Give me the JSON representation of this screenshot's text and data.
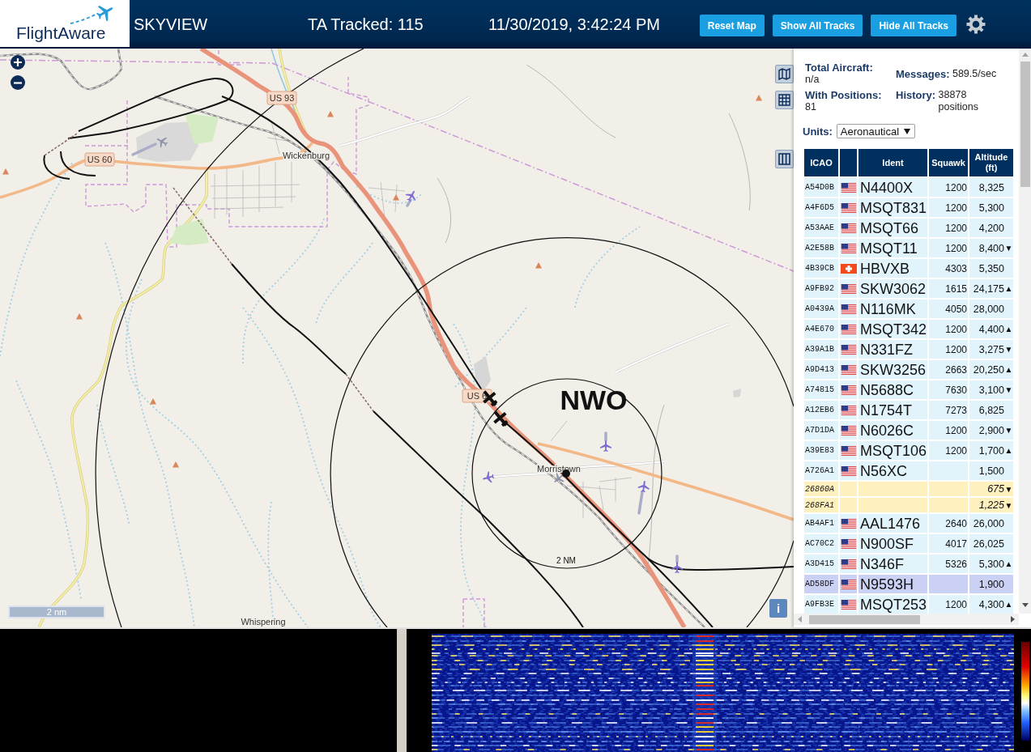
{
  "header": {
    "logo": "FlightAware",
    "title": "SKYVIEW",
    "tracked": "TA Tracked: 115",
    "datetime": "11/30/2019, 3:42:24 PM",
    "buttons": [
      "Reset Map",
      "Show All Tracks",
      "Hide All Tracks"
    ]
  },
  "map": {
    "route_shields": [
      "US 93",
      "US 60",
      "US 6"
    ],
    "places": [
      "Wickenburg",
      "Morristown",
      "Whispering"
    ],
    "airport": "NWO",
    "ring_label": "2 NM",
    "scale": "2 nm",
    "info_button": "i"
  },
  "stats": [
    {
      "label": "Total Aircraft:",
      "value": "n/a"
    },
    {
      "label": "Messages:",
      "value": "589.5/sec"
    },
    {
      "label": "With Positions:",
      "value": "81"
    },
    {
      "label": "History:",
      "value": "38878 positions"
    }
  ],
  "units": {
    "label": "Units:",
    "value": "Aeronautical"
  },
  "table": {
    "columns": [
      "ICAO",
      "Ident",
      "Squawk",
      "Altitude (ft)"
    ],
    "rows": [
      {
        "icao": "A54D0B",
        "flag": {
          "kind": "us"
        },
        "ident": "N4400X",
        "squawk": "1200",
        "altitude": "8,325",
        "kind": "standard",
        "selected": false
      },
      {
        "icao": "A4F6D5",
        "flag": {
          "kind": "us"
        },
        "ident": "MSQT831",
        "squawk": "1200",
        "altitude": "5,300",
        "kind": "standard",
        "selected": false
      },
      {
        "icao": "A53AAE",
        "flag": {
          "kind": "us"
        },
        "ident": "MSQT66",
        "squawk": "1200",
        "altitude": "4,200",
        "kind": "standard",
        "selected": false
      },
      {
        "icao": "A2E58B",
        "flag": {
          "kind": "us"
        },
        "ident": "MSQT11",
        "squawk": "1200",
        "altitude": "8,400",
        "trend": "▼",
        "kind": "standard",
        "selected": false
      },
      {
        "icao": "4B39CB",
        "flag": {
          "kind": "ch"
        },
        "ident": "HBVXB",
        "squawk": "4303",
        "altitude": "5,350",
        "kind": "standard",
        "selected": false
      },
      {
        "icao": "A9FB92",
        "flag": {
          "kind": "us"
        },
        "ident": "SKW3062",
        "squawk": "1615",
        "altitude": "24,175",
        "trend": "▲",
        "kind": "standard",
        "selected": false
      },
      {
        "icao": "A0439A",
        "flag": {
          "kind": "us"
        },
        "ident": "N116MK",
        "squawk": "4050",
        "altitude": "28,000",
        "kind": "standard",
        "selected": false
      },
      {
        "icao": "A4E670",
        "flag": {
          "kind": "us"
        },
        "ident": "MSQT342",
        "squawk": "1200",
        "altitude": "4,400",
        "trend": "▲",
        "kind": "standard",
        "selected": false
      },
      {
        "icao": "A39A1B",
        "flag": {
          "kind": "us"
        },
        "ident": "N331FZ",
        "squawk": "1200",
        "altitude": "3,275",
        "trend": "▼",
        "kind": "standard",
        "selected": false
      },
      {
        "icao": "A9D413",
        "flag": {
          "kind": "us"
        },
        "ident": "SKW3256",
        "squawk": "2663",
        "altitude": "20,250",
        "trend": "▲",
        "kind": "standard",
        "selected": false
      },
      {
        "icao": "A74815",
        "flag": {
          "kind": "us"
        },
        "ident": "N5688C",
        "squawk": "7630",
        "altitude": "3,100",
        "trend": "▼",
        "kind": "standard",
        "selected": false
      },
      {
        "icao": "A12EB6",
        "flag": {
          "kind": "us"
        },
        "ident": "N1754T",
        "squawk": "7273",
        "altitude": "6,825",
        "kind": "standard",
        "selected": false
      },
      {
        "icao": "A7D1DA",
        "flag": {
          "kind": "us"
        },
        "ident": "N6026C",
        "squawk": "1200",
        "altitude": "2,900",
        "trend": "▼",
        "kind": "standard",
        "selected": false
      },
      {
        "icao": "A39E83",
        "flag": {
          "kind": "us"
        },
        "ident": "MSQT106",
        "squawk": "1200",
        "altitude": "1,700",
        "trend": "▲",
        "kind": "standard",
        "selected": false
      },
      {
        "icao": "A726A1",
        "flag": {
          "kind": "us"
        },
        "ident": "N56XC",
        "altitude": "1,500",
        "kind": "standard",
        "selected": false
      },
      {
        "icao": "26860A",
        "altitude": "675",
        "trend": "▼",
        "kind": "alternate",
        "selected": false
      },
      {
        "icao": "268FA1",
        "altitude": "1,225",
        "trend": "▼",
        "kind": "alternate",
        "selected": false
      },
      {
        "icao": "AB4AF1",
        "flag": {
          "kind": "us"
        },
        "ident": "AAL1476",
        "squawk": "2640",
        "altitude": "26,000",
        "kind": "standard",
        "selected": false
      },
      {
        "icao": "AC70C2",
        "flag": {
          "kind": "us"
        },
        "ident": "N900SF",
        "squawk": "4017",
        "altitude": "26,025",
        "kind": "standard",
        "selected": false
      },
      {
        "icao": "A3D415",
        "flag": {
          "kind": "us"
        },
        "ident": "N346F",
        "squawk": "5326",
        "altitude": "5,300",
        "trend": "▲",
        "kind": "standard",
        "selected": false
      },
      {
        "icao": "AD58DF",
        "flag": {
          "kind": "us"
        },
        "ident": "N9593H",
        "altitude": "1,900",
        "kind": "standard",
        "selected": true
      },
      {
        "icao": "A9FB3E",
        "flag": {
          "kind": "us"
        },
        "ident": "MSQT253",
        "squawk": "1200",
        "altitude": "4,300",
        "trend": "▲",
        "kind": "standard",
        "selected": false
      }
    ]
  }
}
